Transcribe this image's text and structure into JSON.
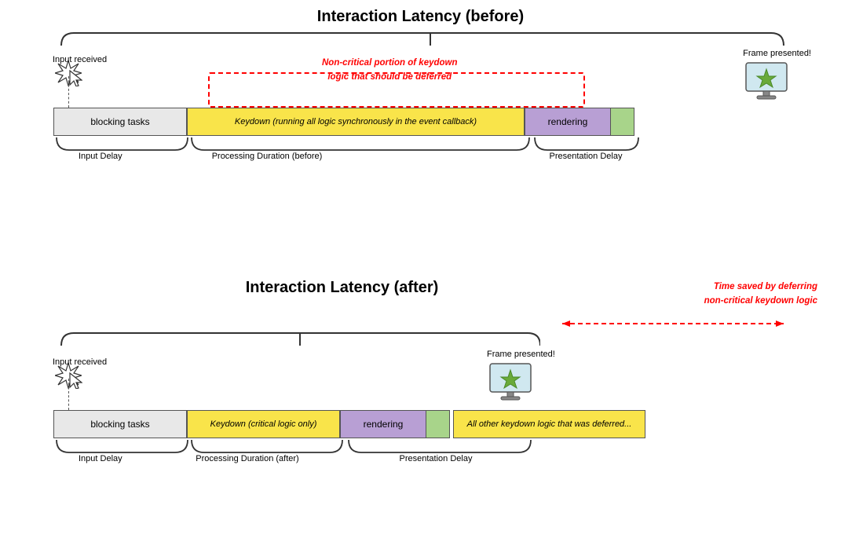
{
  "top": {
    "title": "Interaction Latency (before)",
    "input_received": "Input received",
    "frame_presented": "Frame presented!",
    "non_critical_label": "Non-critical portion of keydown\nlogic that should be deferred",
    "bar_blocking": "blocking tasks",
    "bar_keydown": "Keydown (running all logic synchronously in the event callback)",
    "bar_rendering": "rendering",
    "label_input_delay": "Input Delay",
    "label_processing_duration": "Processing Duration (before)",
    "label_presentation_delay": "Presentation Delay"
  },
  "bottom": {
    "title": "Interaction Latency (after)",
    "input_received": "Input received",
    "frame_presented": "Frame presented!",
    "time_saved_label": "Time saved by deferring\nnon-critical keydown logic",
    "bar_blocking": "blocking tasks",
    "bar_keydown": "Keydown (critical logic only)",
    "bar_rendering": "rendering",
    "bar_deferred": "All other keydown logic that was deferred...",
    "label_input_delay": "Input Delay",
    "label_processing_duration": "Processing Duration (after)",
    "label_presentation_delay": "Presentation Delay"
  }
}
